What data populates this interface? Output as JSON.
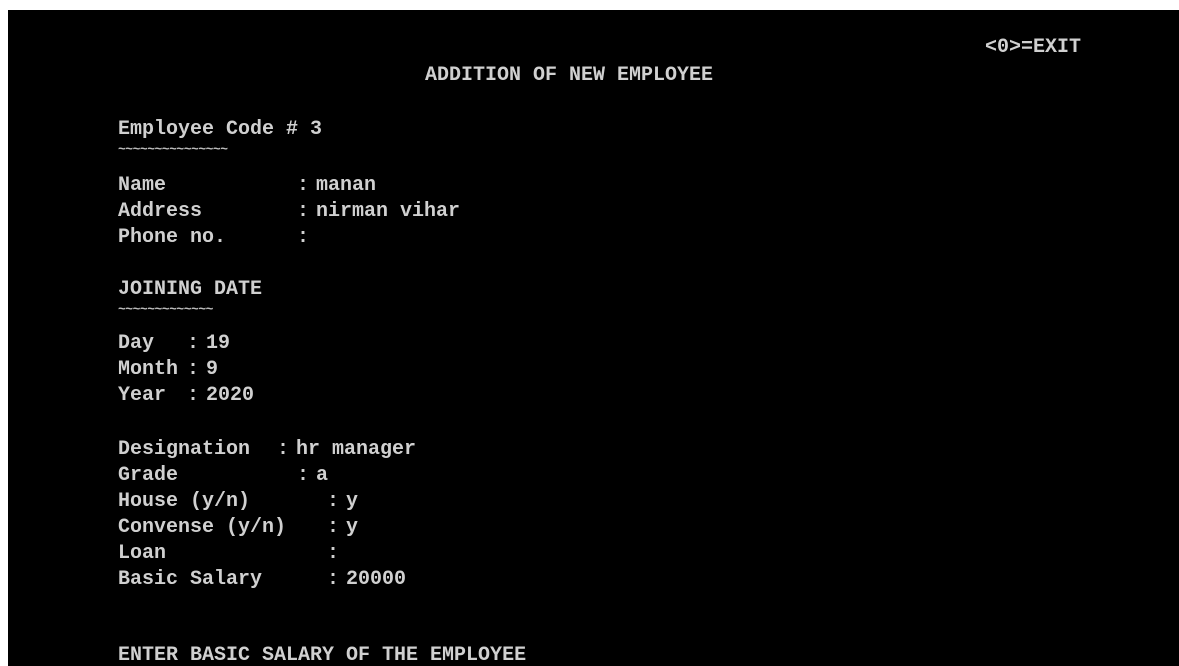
{
  "header": {
    "exit_hint": "<0>=EXIT",
    "title": "ADDITION OF NEW EMPLOYEE"
  },
  "employee": {
    "code_label": "Employee Code # 3",
    "code_underline": "~~~~~~~~~~~~~~~",
    "name_label": "Name",
    "name_sep": ":",
    "name_value": "manan",
    "address_label": "Address",
    "address_sep": ":",
    "address_value": "nirman vihar",
    "phone_label": "Phone no.",
    "phone_sep": ":",
    "phone_value": ""
  },
  "joining_date": {
    "heading": "JOINING DATE",
    "heading_underline": "~~~~~~~~~~~~~",
    "day_label": "Day",
    "day_sep": ":",
    "day_value": "19",
    "month_label": "Month",
    "month_sep": ":",
    "month_value": "9",
    "year_label": "Year",
    "year_sep": ":",
    "year_value": "2020"
  },
  "job": {
    "designation_label": "Designation",
    "designation_sep": ":",
    "designation_value": "hr manager",
    "grade_label": "Grade",
    "grade_sep": ":",
    "grade_value": "a",
    "house_label": "House (y/n)",
    "house_sep": ":",
    "house_value": "y",
    "convense_label": "Convense (y/n)",
    "convense_sep": ":",
    "convense_value": "y",
    "loan_label": "Loan",
    "loan_sep": ":",
    "loan_value": "",
    "salary_label": "Basic Salary",
    "salary_sep": ":",
    "salary_value": "20000"
  },
  "prompt": {
    "text": "ENTER BASIC SALARY OF THE EMPLOYEE"
  },
  "colors": {
    "background": "#000000",
    "text": "#d0d0d0"
  }
}
